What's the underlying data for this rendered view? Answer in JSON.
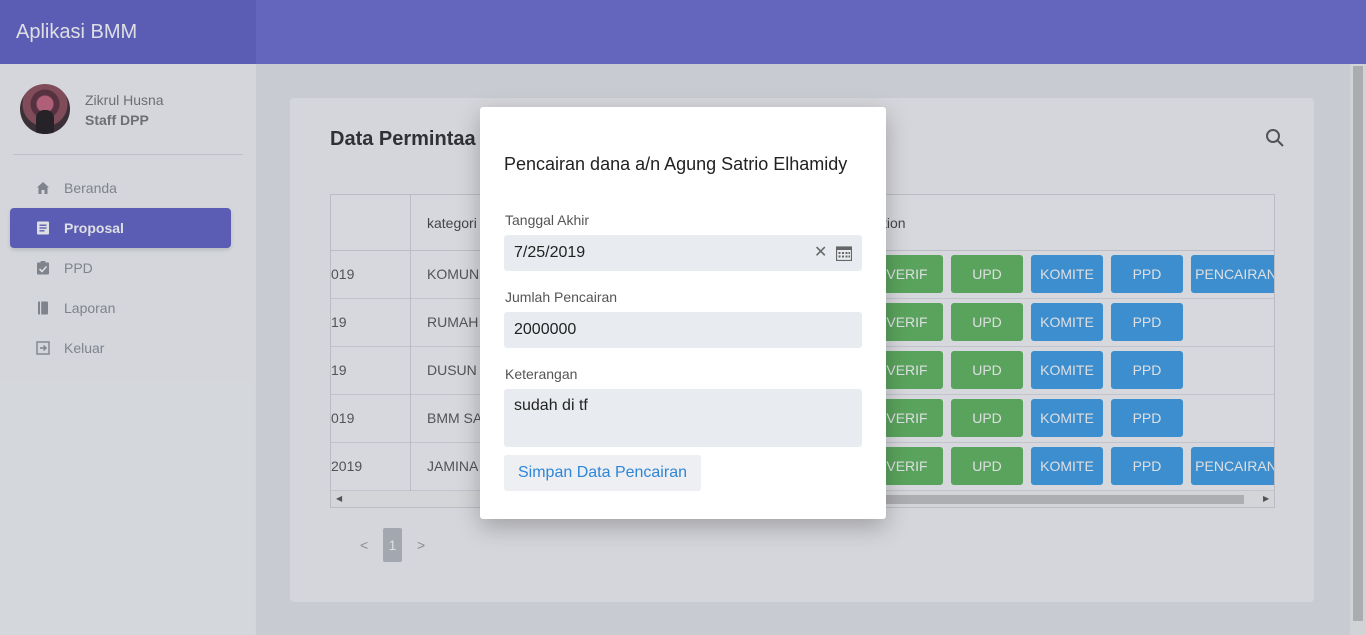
{
  "app": {
    "title": "Aplikasi BMM"
  },
  "user": {
    "name": "Zikrul Husna",
    "role": "Staff DPP"
  },
  "sidebar": {
    "items": [
      {
        "label": "Beranda",
        "icon": "home-icon"
      },
      {
        "label": "Proposal",
        "icon": "document-icon",
        "active": true
      },
      {
        "label": "PPD",
        "icon": "clipboard-check-icon"
      },
      {
        "label": "Laporan",
        "icon": "book-icon"
      },
      {
        "label": "Keluar",
        "icon": "logout-icon"
      }
    ]
  },
  "main": {
    "title": "Data Permintaa",
    "table": {
      "headers": {
        "category": "kategori",
        "action": "tion"
      },
      "rows": [
        {
          "date": "019",
          "category": "KOMUNI",
          "buttons": [
            "VERIF",
            "UPD",
            "KOMITE",
            "PPD",
            "PENCAIRAN"
          ]
        },
        {
          "date": "19",
          "category": "RUMAH",
          "buttons": [
            "VERIF",
            "UPD",
            "KOMITE",
            "PPD"
          ]
        },
        {
          "date": "19",
          "category": "DUSUN Z",
          "buttons": [
            "VERIF",
            "UPD",
            "KOMITE",
            "PPD"
          ]
        },
        {
          "date": "019",
          "category": "BMM SA",
          "buttons": [
            "VERIF",
            "UPD",
            "KOMITE",
            "PPD"
          ]
        },
        {
          "date": "2019",
          "category": "JAMINA",
          "buttons": [
            "VERIF",
            "UPD",
            "KOMITE",
            "PPD",
            "PENCAIRAN"
          ]
        }
      ]
    },
    "pagination": {
      "prev": "<",
      "current": "1",
      "next": ">"
    }
  },
  "dialog": {
    "title": "Pencairan dana a/n Agung Satrio Elhamidy",
    "tanggal_label": "Tanggal Akhir",
    "tanggal_value": "7/25/2019",
    "jumlah_label": "Jumlah Pencairan",
    "jumlah_value": "2000000",
    "keterangan_label": "Keterangan",
    "keterangan_value": "sudah di tf",
    "save_label": "Simpan Data Pencairan"
  },
  "colors": {
    "primary": "#6061c9",
    "topbar": "#6b6cd3",
    "green_button": "#5fb65d",
    "blue_button": "#3b9de8",
    "link": "#2e86d8"
  }
}
